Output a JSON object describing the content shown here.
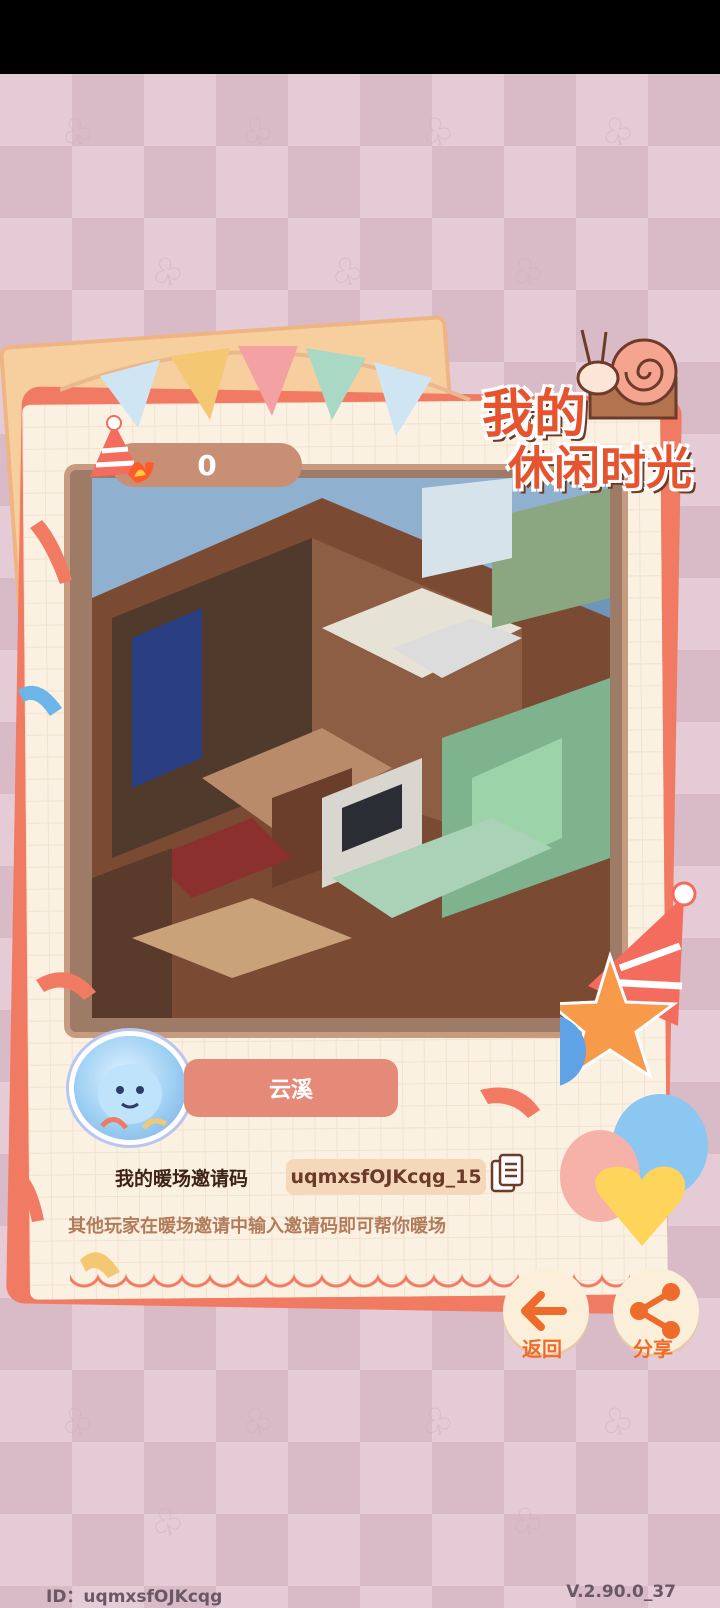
{
  "header": {
    "score": "0"
  },
  "title": {
    "line1": "我的",
    "line2": "休闲时光"
  },
  "player": {
    "name": "云溪"
  },
  "invite": {
    "label": "我的暖场邀请码",
    "code": "uqmxsfOJKcqg_15",
    "hint": "其他玩家在暖场邀请中输入邀请码即可帮你暖场"
  },
  "actions": {
    "back_label": "返回",
    "share_label": "分享"
  },
  "footer": {
    "id_text": "ID：uqmxsfOJKcqg",
    "version": "V.2.90.0_37"
  },
  "icons": {
    "hat": "party-hat-icon",
    "copy": "copy-icon",
    "back": "arrow-left-icon",
    "share": "share-icon",
    "snail": "snail-icon"
  },
  "colors": {
    "accent": "#ef6b2b",
    "frame": "#f07b62",
    "paper": "#fbf1e3"
  }
}
